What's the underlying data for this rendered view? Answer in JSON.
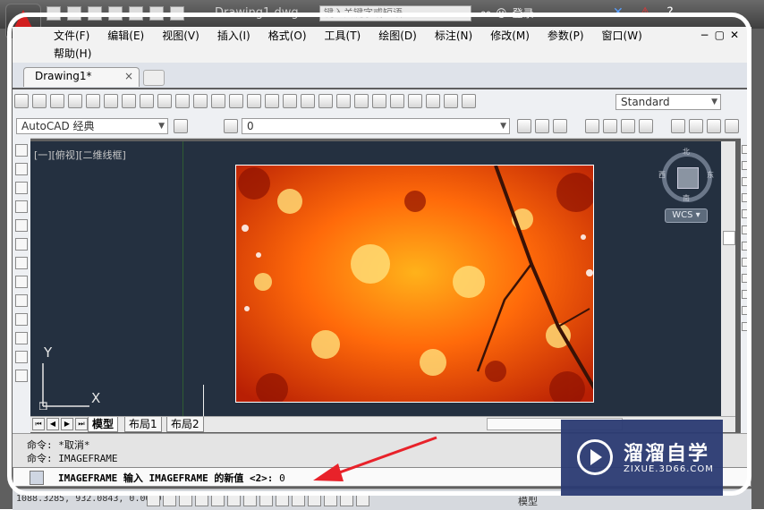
{
  "window": {
    "title": "Drawing1.dwg",
    "search_placeholder": "键入关键字或短语",
    "login_label": "登录"
  },
  "menu": {
    "items": [
      "文件(F)",
      "编辑(E)",
      "视图(V)",
      "插入(I)",
      "格式(O)",
      "工具(T)",
      "绘图(D)",
      "标注(N)",
      "修改(M)",
      "参数(P)",
      "窗口(W)"
    ],
    "second_row": "帮助(H)"
  },
  "document_tab": {
    "label": "Drawing1*",
    "close": "×"
  },
  "toolbar": {
    "text_style": "Standard",
    "workspace": "AutoCAD 经典",
    "layer": "0"
  },
  "viewport": {
    "label": "[一][俯视][二维线框]",
    "wcs": "WCS",
    "compass": {
      "north": "北",
      "south": "南",
      "east": "东",
      "west": "西"
    },
    "ucs_x": "X",
    "ucs_y": "Y"
  },
  "layout_tabs": [
    "模型",
    "布局1",
    "布局2"
  ],
  "command_history": [
    "命令: *取消*",
    "命令: IMAGEFRAME"
  ],
  "command_prompt": {
    "text": "IMAGEFRAME 输入 IMAGEFRAME 的新值 <2>: ",
    "value": "0"
  },
  "status": {
    "coordinates": "1088.3285, 932.0843, 0.0000",
    "model_label": "模型"
  },
  "watermark": {
    "title": "溜溜自学",
    "subtitle": "ZIXUE.3D66.COM"
  },
  "colors": {
    "canvas_bg": "#243040",
    "annotation_arrow": "#e8222a",
    "watermark_bg": "#2b3b73"
  }
}
